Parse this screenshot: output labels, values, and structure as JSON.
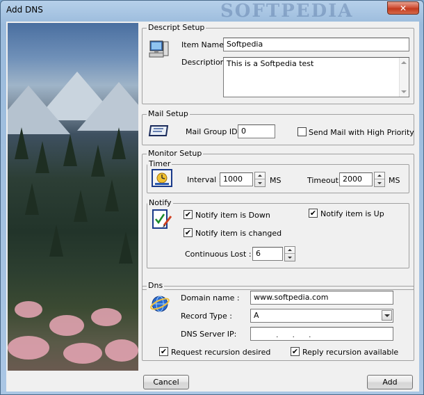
{
  "window": {
    "title": "Add DNS",
    "close_glyph": "✕",
    "watermark": "SOFTPEDIA"
  },
  "descript_setup": {
    "legend": "Descript  Setup",
    "item_name_label": "Item Name:",
    "item_name_value": "Softpedia",
    "description_label": "Description:",
    "description_value": "This is a Softpedia test"
  },
  "mail_setup": {
    "legend": "Mail  Setup",
    "group_id_label": "Mail Group ID:",
    "group_id_value": "0",
    "high_priority_label": "Send Mail with High Priority",
    "high_priority_checked": false
  },
  "monitor_setup": {
    "legend": "Monitor  Setup",
    "timer": {
      "legend": "Timer",
      "interval_label": "Interval :",
      "interval_value": "1000",
      "interval_unit": "MS",
      "timeout_label": "Timeout",
      "timeout_value": "2000",
      "timeout_unit": "MS"
    },
    "notify": {
      "legend": "Notify",
      "down_label": "Notify item is Down",
      "down_checked": true,
      "up_label": "Notify item is Up",
      "up_checked": true,
      "changed_label": "Notify item is changed",
      "changed_checked": true,
      "lost_label": "Continuous Lost :",
      "lost_value": "6"
    }
  },
  "dns": {
    "legend": "Dns",
    "domain_label": "Domain name :",
    "domain_value": "www.softpedia.com",
    "record_type_label": "Record Type :",
    "record_type_value": "A",
    "server_ip_label": "DNS Server IP:",
    "request_recursion_label": "Request recursion desired",
    "request_recursion_checked": true,
    "reply_recursion_label": "Reply recursion available",
    "reply_recursion_checked": true
  },
  "buttons": {
    "cancel": "Cancel",
    "add": "Add"
  },
  "check_glyph": "✔",
  "icons": [
    "computer-icon",
    "mail-card-icon",
    "clock-icon",
    "checklist-icon",
    "globe-icon"
  ],
  "colors": {
    "title_gradient": "#9bbbdc",
    "close": "#c23a1e",
    "panel": "#f0f0f0"
  }
}
